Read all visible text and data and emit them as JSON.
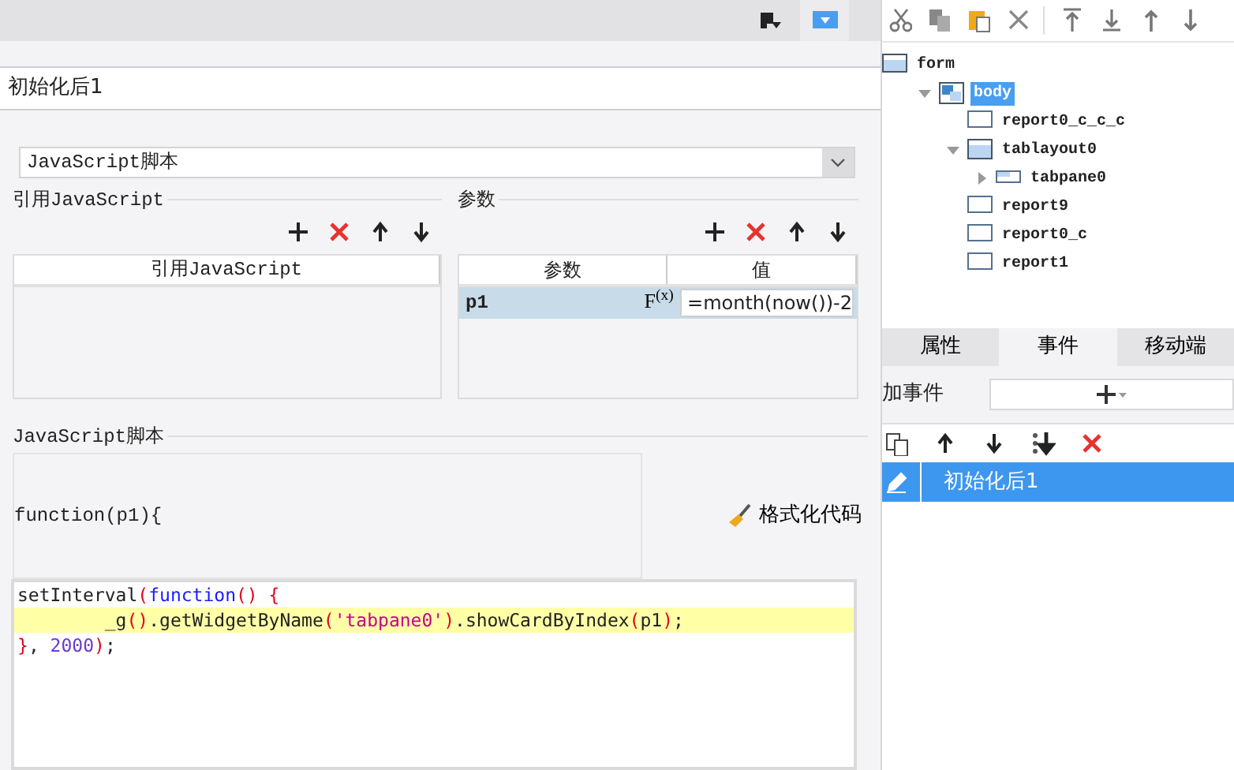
{
  "dialog": {
    "title": "初始化后1",
    "type_select": {
      "value": "JavaScript脚本"
    },
    "imports": {
      "title": "引用JavaScript",
      "columns": [
        "引用JavaScript"
      ]
    },
    "params": {
      "title": "参数",
      "columns": [
        "参数",
        "值"
      ],
      "rows": [
        {
          "name": "p1",
          "formula_button": "F$^{(x)}$",
          "value": "=month(now())-2",
          "selected": true
        }
      ]
    },
    "script": {
      "title": "JavaScript脚本",
      "signature": "function(p1){",
      "format_button": "格式化代码",
      "lines": [
        {
          "highlighted": false,
          "tokens": [
            {
              "kind": "plain",
              "text": "setInterval"
            },
            {
              "kind": "punct",
              "text": "("
            },
            {
              "kind": "keyword",
              "text": "function"
            },
            {
              "kind": "punct",
              "text": "() {"
            }
          ]
        },
        {
          "highlighted": true,
          "tokens": [
            {
              "kind": "plain",
              "text": "        _g"
            },
            {
              "kind": "punct",
              "text": "()"
            },
            {
              "kind": "plain",
              "text": ".getWidgetByName"
            },
            {
              "kind": "punct",
              "text": "("
            },
            {
              "kind": "string",
              "text": "'tabpane0'"
            },
            {
              "kind": "punct",
              "text": ")"
            },
            {
              "kind": "plain",
              "text": ".showCardByIndex"
            },
            {
              "kind": "punct",
              "text": "("
            },
            {
              "kind": "plain",
              "text": "p1"
            },
            {
              "kind": "punct",
              "text": ")"
            },
            {
              "kind": "plain",
              "text": ";"
            }
          ]
        },
        {
          "highlighted": false,
          "tokens": [
            {
              "kind": "punct",
              "text": "}"
            },
            {
              "kind": "plain",
              "text": ", "
            },
            {
              "kind": "number",
              "text": "2000"
            },
            {
              "kind": "punct",
              "text": ")"
            },
            {
              "kind": "plain",
              "text": ";"
            }
          ]
        }
      ]
    }
  },
  "structure_tree": {
    "nodes": [
      {
        "label": "form",
        "kind": "form",
        "selected": false,
        "children": [
          {
            "label": "body",
            "kind": "body",
            "selected": true,
            "expanded": true,
            "children": [
              {
                "label": "report0_c_c_c",
                "kind": "report",
                "selected": false
              },
              {
                "label": "tablayout0",
                "kind": "tablayout",
                "selected": false,
                "expanded": true,
                "children": [
                  {
                    "label": "tabpane0",
                    "kind": "tabpane",
                    "selected": false,
                    "expanded": false
                  }
                ]
              },
              {
                "label": "report9",
                "kind": "report",
                "selected": false
              },
              {
                "label": "report0_c",
                "kind": "report",
                "selected": false
              },
              {
                "label": "report1",
                "kind": "report",
                "selected": false
              }
            ]
          }
        ]
      }
    ]
  },
  "tabs": [
    {
      "label": "属性",
      "selected": false
    },
    {
      "label": "事件",
      "selected": true
    },
    {
      "label": "移动端",
      "selected": false
    }
  ],
  "events": {
    "add_label": "加事件",
    "items": [
      {
        "label": "初始化后1",
        "selected": true
      }
    ]
  }
}
